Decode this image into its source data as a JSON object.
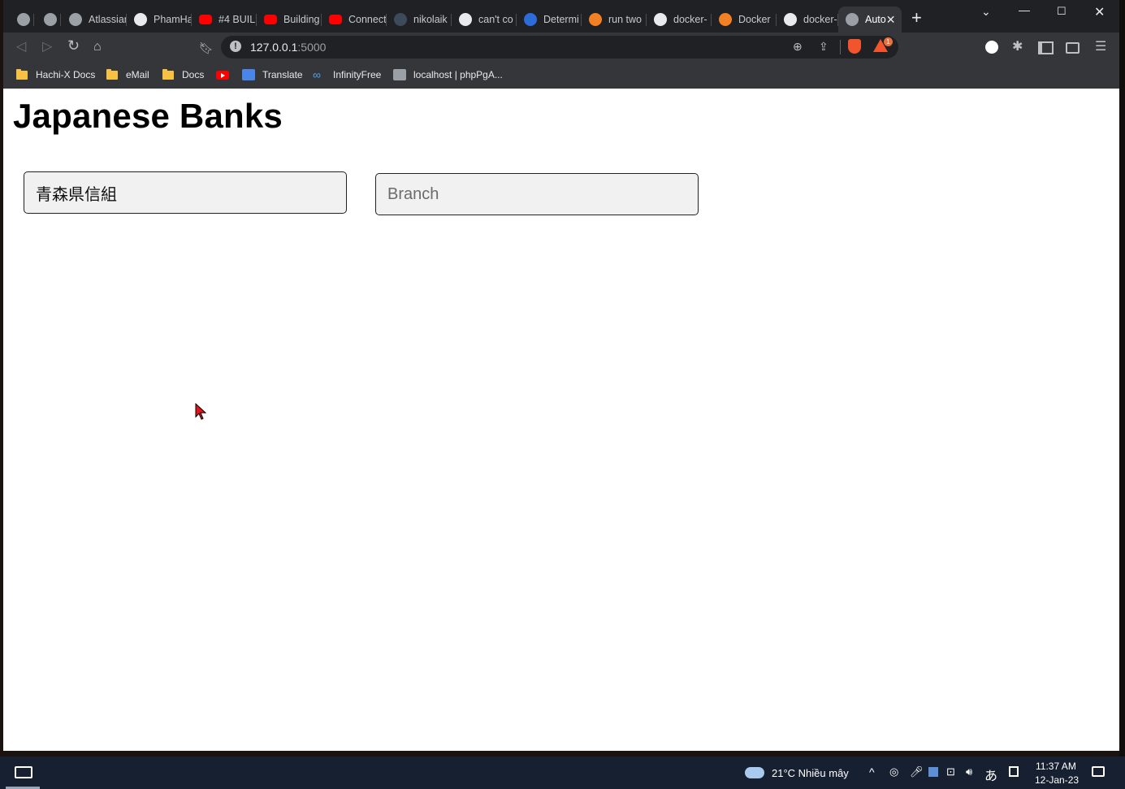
{
  "browser": {
    "tabs": [
      {
        "label": "",
        "icon": "globe-icon"
      },
      {
        "label": "",
        "icon": "h-square-icon"
      },
      {
        "label": "Atlassian",
        "icon": "globe-icon"
      },
      {
        "label": "PhamHa",
        "icon": "github-icon"
      },
      {
        "label": "#4 BUIL",
        "icon": "youtube-icon"
      },
      {
        "label": "Building",
        "icon": "youtube-icon"
      },
      {
        "label": "Connect",
        "icon": "youtube-icon"
      },
      {
        "label": "nikolaik",
        "icon": "circle-icon"
      },
      {
        "label": "can't co",
        "icon": "google-icon"
      },
      {
        "label": "Determi",
        "icon": "chart-icon"
      },
      {
        "label": "run two",
        "icon": "stackoverflow-icon"
      },
      {
        "label": "docker-",
        "icon": "google-icon"
      },
      {
        "label": "Docker",
        "icon": "stackoverflow-icon"
      },
      {
        "label": "docker-",
        "icon": "github-icon"
      },
      {
        "label": "Auto",
        "icon": "globe-icon",
        "active": true
      }
    ],
    "address": {
      "host": "127.0.0.1",
      "port": ":5000"
    },
    "brave_badge": "1",
    "bookmarks": [
      {
        "label": "Hachi-X Docs",
        "icon": "folder-icon"
      },
      {
        "label": "eMail",
        "icon": "folder-icon"
      },
      {
        "label": "Docs",
        "icon": "folder-icon"
      },
      {
        "label": "",
        "icon": "youtube-icon"
      },
      {
        "label": "Translate",
        "icon": "translate-icon"
      },
      {
        "label": "InfinityFree",
        "icon": "infinity-icon"
      },
      {
        "label": "localhost | phpPgA...",
        "icon": "elephant-icon"
      }
    ]
  },
  "page": {
    "title": "Japanese Banks",
    "bank_input": {
      "value": "青森県信組",
      "placeholder": ""
    },
    "branch_input": {
      "value": "",
      "placeholder": "Branch"
    }
  },
  "taskbar": {
    "weather": "21°C  Nhiều mây",
    "ime": "あ",
    "time": "11:37 AM",
    "date": "12-Jan-23"
  }
}
